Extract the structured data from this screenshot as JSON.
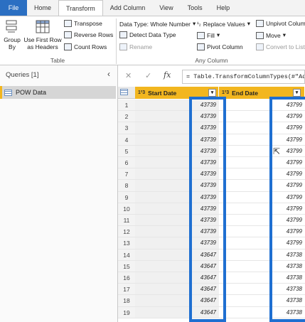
{
  "tabs": [
    "File",
    "Home",
    "Transform",
    "Add Column",
    "View",
    "Tools",
    "Help"
  ],
  "ribbon": {
    "group_by": "Group\nBy",
    "use_first_row": "Use First Row\nas Headers",
    "transpose": "Transpose",
    "reverse_rows": "Reverse Rows",
    "count_rows": "Count Rows",
    "table_group": "Table",
    "data_type": "Data Type: Whole Number",
    "detect_data_type": "Detect Data Type",
    "rename": "Rename",
    "replace_values": "Replace Values",
    "fill": "Fill",
    "pivot_column": "Pivot Column",
    "unpivot_columns": "Unpivot Colum",
    "move": "Move",
    "convert_to_list": "Convert to List",
    "any_column_group": "Any Column"
  },
  "queries": {
    "header": "Queries [1]",
    "items": [
      "POW Data"
    ]
  },
  "formula": {
    "text": "= Table.TransformColumnTypes(#\"Added"
  },
  "columns": [
    {
      "type": "1²3",
      "name": "Start Date"
    },
    {
      "type": "1²3",
      "name": "End Date"
    }
  ],
  "rows": [
    {
      "n": "1",
      "start": "43739",
      "end": "43799"
    },
    {
      "n": "2",
      "start": "43739",
      "end": "43799"
    },
    {
      "n": "3",
      "start": "43739",
      "end": "43799"
    },
    {
      "n": "4",
      "start": "43739",
      "end": "43799"
    },
    {
      "n": "5",
      "start": "43739",
      "end": "43799"
    },
    {
      "n": "6",
      "start": "43739",
      "end": "43799"
    },
    {
      "n": "7",
      "start": "43739",
      "end": "43799"
    },
    {
      "n": "8",
      "start": "43739",
      "end": "43799"
    },
    {
      "n": "9",
      "start": "43739",
      "end": "43799"
    },
    {
      "n": "10",
      "start": "43739",
      "end": "43799"
    },
    {
      "n": "11",
      "start": "43739",
      "end": "43799"
    },
    {
      "n": "12",
      "start": "43739",
      "end": "43799"
    },
    {
      "n": "13",
      "start": "43739",
      "end": "43799"
    },
    {
      "n": "14",
      "start": "43647",
      "end": "43738"
    },
    {
      "n": "15",
      "start": "43647",
      "end": "43738"
    },
    {
      "n": "16",
      "start": "43647",
      "end": "43738"
    },
    {
      "n": "17",
      "start": "43647",
      "end": "43738"
    },
    {
      "n": "18",
      "start": "43647",
      "end": "43738"
    },
    {
      "n": "19",
      "start": "43647",
      "end": "43738"
    }
  ],
  "highlight_color": "#1f6fd1",
  "column_header_color": "#f2b61f",
  "file_tab_color": "#2b6fc2"
}
